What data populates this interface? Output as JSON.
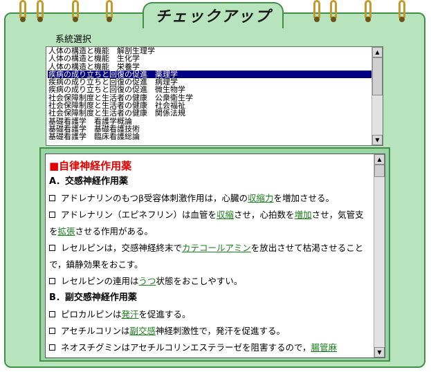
{
  "title": "チェックアップ",
  "system_select": {
    "label": "系統選択",
    "items": [
      "人体の構造と機能　解剖生理学",
      "人体の構造と機能　生化学",
      "人体の構造と機能　栄養学",
      "疾病の成り立ちと回復の促進　薬理学",
      "疾病の成り立ちと回復の促進　病理学",
      "疾病の成り立ちと回復の促進　微生物学",
      "社会保障制度と生活者の健康　公衆衛生学",
      "社会保障制度と生活者の健康　社会福祉",
      "社会保障制度と生活者の健康　関係法規",
      "基礎看護学　看護学概論",
      "基礎看護学　基礎看護技術",
      "基礎看護学　臨床看護総論"
    ],
    "selected_index": 3
  },
  "content": {
    "heading": "■自律神経作用薬",
    "sections": [
      {
        "title": "A．交感神経作用薬",
        "items": [
          [
            {
              "t": "アドレナリンのもつβ受容体刺激作用は，心臓の"
            },
            {
              "t": "収縮力",
              "k": true
            },
            {
              "t": "を増加させる。"
            }
          ],
          [
            {
              "t": "アドレナリン（エピネフリン）は血管を"
            },
            {
              "t": "収縮",
              "k": true
            },
            {
              "t": "させ，心拍数を"
            },
            {
              "t": "増加",
              "k": true
            },
            {
              "t": "させ，気管支を"
            },
            {
              "t": "拡張",
              "k": true
            },
            {
              "t": "させる作用がある。"
            }
          ],
          [
            {
              "t": "レセルピンは，交感神経終末で"
            },
            {
              "t": "カテコールアミン",
              "k": true
            },
            {
              "t": "を放出させて枯渇させることで，鎮静効果をおこす。"
            }
          ],
          [
            {
              "t": "レセルピンの連用は"
            },
            {
              "t": "うつ",
              "k": true
            },
            {
              "t": "状態をおこしやすい。"
            }
          ]
        ]
      },
      {
        "title": "B．副交感神経作用薬",
        "items": [
          [
            {
              "t": "ピロカルピンは"
            },
            {
              "t": "発汗",
              "k": true
            },
            {
              "t": "を促進する。"
            }
          ],
          [
            {
              "t": "アセチルコリンは"
            },
            {
              "t": "副交感",
              "k": true
            },
            {
              "t": "神経刺激性で，発汗を促進する。"
            }
          ],
          [
            {
              "t": "ネオスチグミンはアセチルコリンエステラーゼを阻害するので，"
            },
            {
              "t": "腸管麻",
              "k": true
            }
          ]
        ]
      }
    ]
  },
  "scrollbar": {
    "up": "▲",
    "down": "▼"
  },
  "colors": {
    "card": "#b7e4bd",
    "border": "#3f8f47",
    "ring": "#c59a2a",
    "selected": "#000080",
    "keyword": "#1a7f1a",
    "heading": "#e00000"
  },
  "icons": {
    "ring": "spiral-ring-icon",
    "checkbox": "checkbox-icon"
  }
}
